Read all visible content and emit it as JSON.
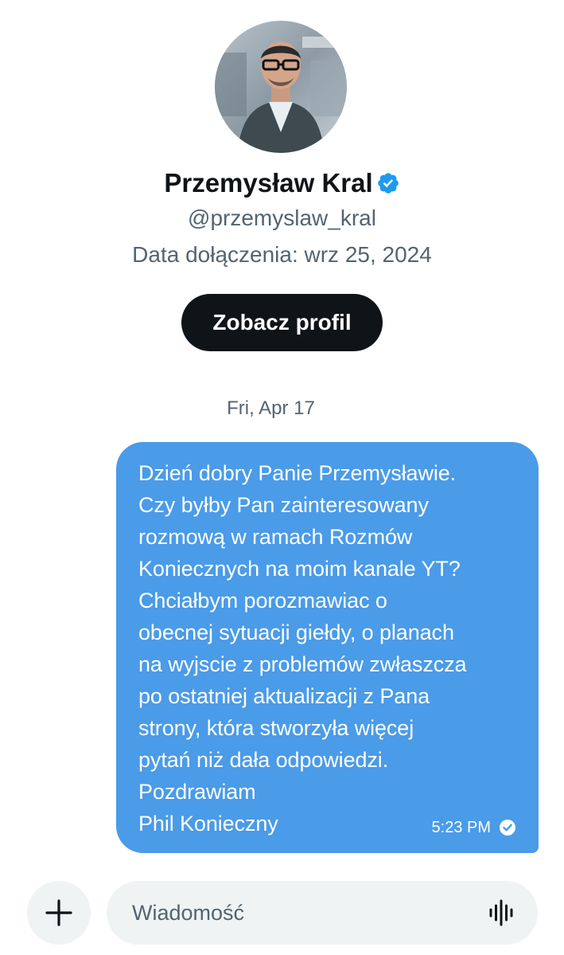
{
  "profile": {
    "name": "Przemysław Kral",
    "handle": "@przemyslaw_kral",
    "joined": "Data dołączenia: wrz 25, 2024",
    "view_profile_label": "Zobacz profil",
    "verified_icon": "verified-badge-icon",
    "verified_color": "#1d9bf0"
  },
  "conversation": {
    "date_separator": "Fri, Apr 17",
    "messages": [
      {
        "direction": "outgoing",
        "text": "Dzień dobry Panie Przemysławie.\nCzy byłby Pan zainteresowany\nrozmową w ramach Rozmów\nKoniecznych na moim kanale YT?\nChciałbym porozmawiac o\nobecnej sytuacji giełdy, o planach\nna wyjscie z problemów zwłaszcza\npo ostatniej aktualizacji z Pana\nstrony, która stworzyła więcej\npytań niż dała odpowiedzi.\nPozdrawiam\nPhil Konieczny",
        "time": "5:23 PM",
        "status_icon": "read-check-icon",
        "bubble_color": "#4a9be8"
      }
    ]
  },
  "composer": {
    "placeholder": "Wiadomość",
    "value": "",
    "add_icon": "plus-icon",
    "voice_icon": "voice-waveform-icon"
  }
}
